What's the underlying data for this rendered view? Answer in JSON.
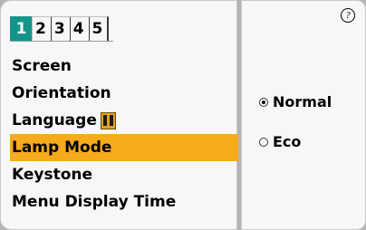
{
  "tabs": [
    {
      "label": "1",
      "active": true
    },
    {
      "label": "2",
      "active": false
    },
    {
      "label": "3",
      "active": false
    },
    {
      "label": "4",
      "active": false
    },
    {
      "label": "5",
      "active": false
    }
  ],
  "menu": {
    "items": [
      {
        "label": "Screen"
      },
      {
        "label": "Orientation"
      },
      {
        "label": "Language",
        "icon": "language-icon"
      },
      {
        "label": "Lamp Mode",
        "selected": true
      },
      {
        "label": "Keystone"
      },
      {
        "label": "Menu Display Time"
      }
    ]
  },
  "options": {
    "help_icon": "help-icon",
    "items": [
      {
        "label": "Normal",
        "checked": true
      },
      {
        "label": "Eco",
        "checked": false
      }
    ]
  },
  "colors": {
    "active_tab": "#14958a",
    "selected_item": "#f5ab1c",
    "panel": "#f7f7f7",
    "background": "#b4b4b4"
  }
}
